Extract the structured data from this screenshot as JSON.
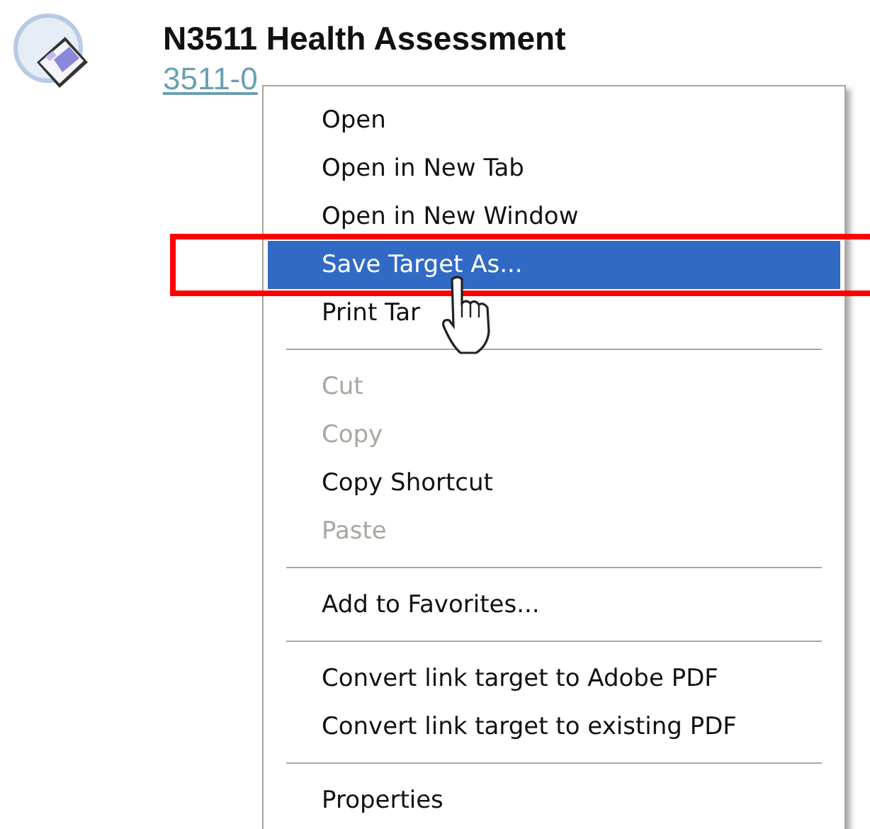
{
  "document": {
    "title": "N3511 Health Assessment",
    "link": "3511-0"
  },
  "context_menu": {
    "items": [
      {
        "kind": "item",
        "label": "Open",
        "disabled": false,
        "selected": false
      },
      {
        "kind": "item",
        "label": "Open in New Tab",
        "disabled": false,
        "selected": false
      },
      {
        "kind": "item",
        "label": "Open in New Window",
        "disabled": false,
        "selected": false
      },
      {
        "kind": "item",
        "label": "Save Target As...",
        "disabled": false,
        "selected": true
      },
      {
        "kind": "item",
        "label": "Print Tar",
        "disabled": false,
        "selected": false
      },
      {
        "kind": "separator"
      },
      {
        "kind": "item",
        "label": "Cut",
        "disabled": true,
        "selected": false
      },
      {
        "kind": "item",
        "label": "Copy",
        "disabled": true,
        "selected": false
      },
      {
        "kind": "item",
        "label": "Copy Shortcut",
        "disabled": false,
        "selected": false
      },
      {
        "kind": "item",
        "label": "Paste",
        "disabled": true,
        "selected": false
      },
      {
        "kind": "separator"
      },
      {
        "kind": "item",
        "label": "Add to Favorites...",
        "disabled": false,
        "selected": false
      },
      {
        "kind": "separator"
      },
      {
        "kind": "item",
        "label": "Convert link target to Adobe PDF",
        "disabled": false,
        "selected": false
      },
      {
        "kind": "item",
        "label": "Convert link target to existing PDF",
        "disabled": false,
        "selected": false
      },
      {
        "kind": "separator"
      },
      {
        "kind": "item",
        "label": "Properties",
        "disabled": false,
        "selected": false
      }
    ]
  }
}
